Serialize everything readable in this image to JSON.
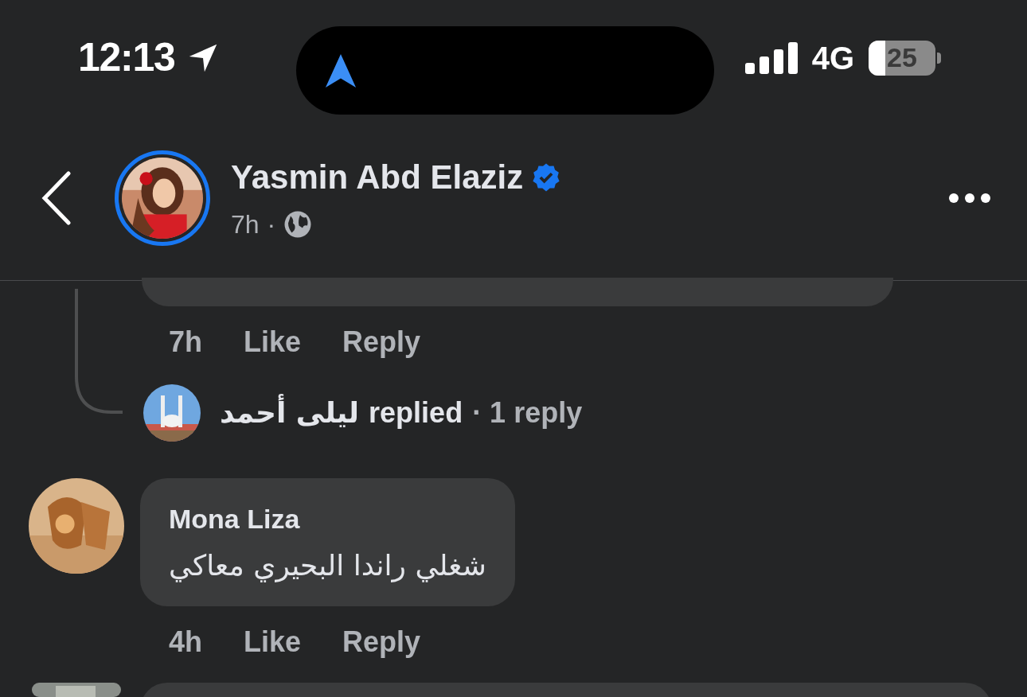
{
  "status_bar": {
    "time": "12:13",
    "network": "4G",
    "battery": "25"
  },
  "post_header": {
    "author": "Yasmin Abd Elaziz",
    "verified": true,
    "time": "7h",
    "separator": "·"
  },
  "previous_comment": {
    "time": "7h",
    "actions": [
      "Like",
      "Reply"
    ]
  },
  "reply_summary": {
    "replier": "ليلى أحمد",
    "verb": "replied",
    "count": "· 1 reply"
  },
  "comments": [
    {
      "author": "Mona Liza",
      "text": "شغلي راندا البحيري معاكي",
      "time": "4h",
      "actions": [
        "Like",
        "Reply"
      ]
    }
  ]
}
